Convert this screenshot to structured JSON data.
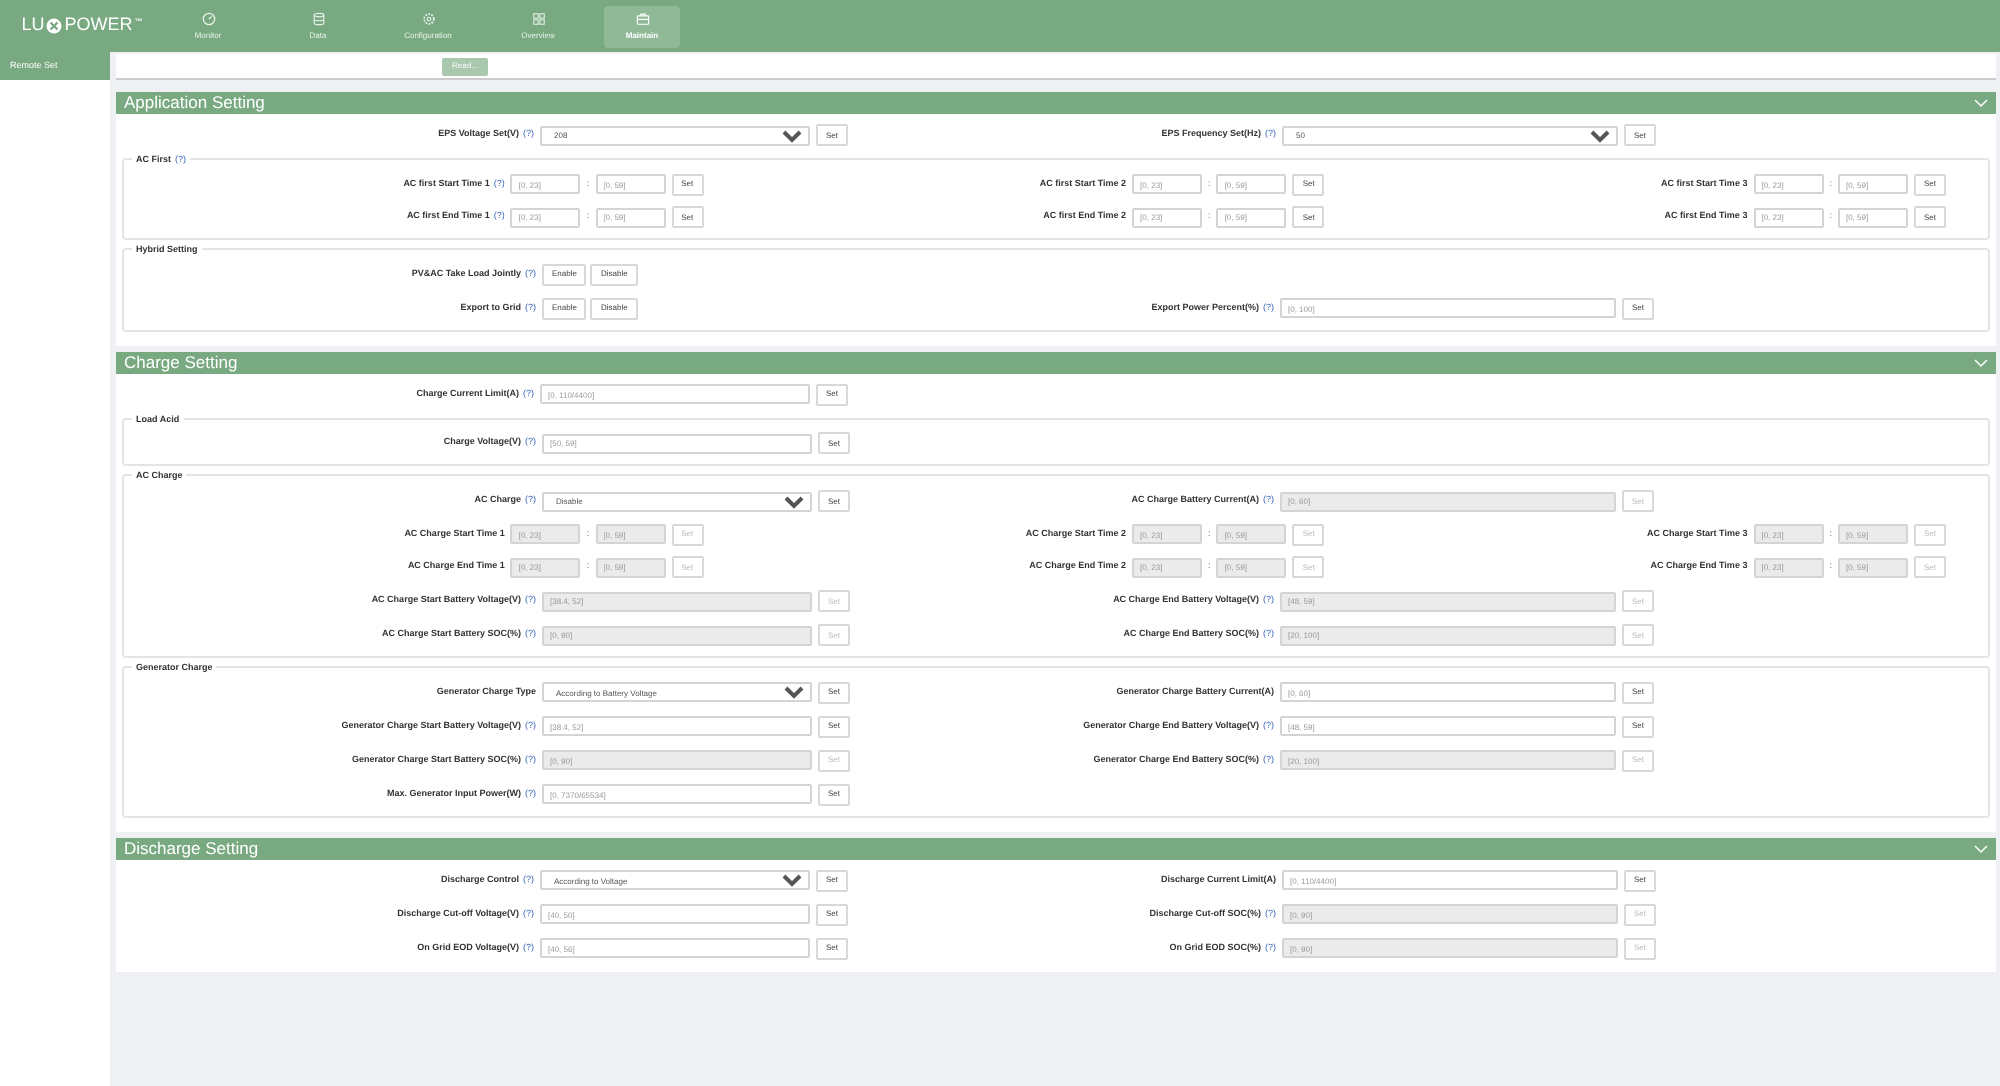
{
  "logo": {
    "before": "LU",
    "after": "POWER",
    "trademark": "™"
  },
  "nav": [
    {
      "label": "Monitor",
      "selected": false
    },
    {
      "label": "Data",
      "selected": false
    },
    {
      "label": "Configuration",
      "selected": false
    },
    {
      "label": "Overview",
      "selected": false
    },
    {
      "label": "Maintain",
      "selected": true
    }
  ],
  "sidebar": {
    "items": [
      {
        "label": "Remote Set",
        "selected": true
      }
    ]
  },
  "toolbar": {
    "read_button": "Read..."
  },
  "sections": [
    {
      "title": "Application Setting",
      "expanded": true,
      "items": [
        {
          "kind": "pair",
          "fields": [
            {
              "kind": "select",
              "label": "EPS Voltage Set(V)",
              "help": "(?)",
              "value": "208",
              "button": "Set",
              "disabled": false
            },
            {
              "kind": "select",
              "label": "EPS Frequency Set(Hz)",
              "help": "(?)",
              "value": "50",
              "button": "Set",
              "disabled": false
            }
          ]
        },
        {
          "kind": "group",
          "legend": "AC First",
          "help": "(?)",
          "items": [
            {
              "kind": "triple",
              "fields": [
                {
                  "kind": "time",
                  "label": "AC first Start Time 1",
                  "help": "(?)",
                  "placeholders": [
                    "[0, 23]",
                    "[0, 59]"
                  ],
                  "separator": ":",
                  "button": "Set",
                  "disabled": false
                },
                {
                  "kind": "time",
                  "label": "AC first Start Time 2",
                  "placeholders": [
                    "[0, 23]",
                    "[0, 59]"
                  ],
                  "separator": ":",
                  "button": "Set",
                  "disabled": false
                },
                {
                  "kind": "time",
                  "label": "AC first Start Time 3",
                  "placeholders": [
                    "[0, 23]",
                    "[0, 59]"
                  ],
                  "separator": ":",
                  "button": "Set",
                  "disabled": false
                }
              ]
            },
            {
              "kind": "triple",
              "fields": [
                {
                  "kind": "time",
                  "label": "AC first End Time 1",
                  "help": "(?)",
                  "placeholders": [
                    "[0, 23]",
                    "[0, 59]"
                  ],
                  "separator": ":",
                  "button": "Set",
                  "disabled": false
                },
                {
                  "kind": "time",
                  "label": "AC first End Time 2",
                  "placeholders": [
                    "[0, 23]",
                    "[0, 59]"
                  ],
                  "separator": ":",
                  "button": "Set",
                  "disabled": false
                },
                {
                  "kind": "time",
                  "label": "AC first End Time 3",
                  "placeholders": [
                    "[0, 23]",
                    "[0, 59]"
                  ],
                  "separator": ":",
                  "button": "Set",
                  "disabled": false
                }
              ]
            }
          ]
        },
        {
          "kind": "group",
          "legend": "Hybrid Setting",
          "items": [
            {
              "kind": "pair",
              "fields": [
                {
                  "kind": "toggle",
                  "label": "PV&AC Take Load Jointly",
                  "help": "(?)",
                  "options": [
                    "Enable",
                    "Disable"
                  ]
                }
              ]
            },
            {
              "kind": "pair",
              "fields": [
                {
                  "kind": "toggle",
                  "label": "Export to Grid",
                  "help": "(?)",
                  "options": [
                    "Enable",
                    "Disable"
                  ]
                },
                {
                  "kind": "input",
                  "label": "Export Power Percent(%)",
                  "help": "(?)",
                  "placeholder": "[0, 100]",
                  "button": "Set",
                  "disabled": false
                }
              ]
            }
          ]
        }
      ]
    },
    {
      "title": "Charge Setting",
      "expanded": true,
      "items": [
        {
          "kind": "pair",
          "fields": [
            {
              "kind": "input",
              "label": "Charge Current Limit(A)",
              "help": "(?)",
              "placeholder": "[0, 110/4400]",
              "button": "Set",
              "disabled": false
            }
          ]
        },
        {
          "kind": "group",
          "legend": "Load Acid",
          "items": [
            {
              "kind": "pair",
              "fields": [
                {
                  "kind": "input",
                  "label": "Charge Voltage(V)",
                  "help": "(?)",
                  "placeholder": "[50, 59]",
                  "button": "Set",
                  "disabled": false
                }
              ]
            }
          ]
        },
        {
          "kind": "group",
          "legend": "AC Charge",
          "items": [
            {
              "kind": "pair",
              "fields": [
                {
                  "kind": "select",
                  "label": "AC Charge",
                  "help": "(?)",
                  "value": "Disable",
                  "button": "Set",
                  "disabled": false
                },
                {
                  "kind": "input",
                  "label": "AC Charge Battery Current(A)",
                  "help": "(?)",
                  "placeholder": "[0, 60]",
                  "button": "Set",
                  "disabled": true
                }
              ]
            },
            {
              "kind": "triple",
              "fields": [
                {
                  "kind": "time",
                  "label": "AC Charge Start Time 1",
                  "placeholders": [
                    "[0, 23]",
                    "[0, 59]"
                  ],
                  "separator": ":",
                  "button": "Set",
                  "disabled": true
                },
                {
                  "kind": "time",
                  "label": "AC Charge Start Time 2",
                  "placeholders": [
                    "[0, 23]",
                    "[0, 59]"
                  ],
                  "separator": ":",
                  "button": "Set",
                  "disabled": true
                },
                {
                  "kind": "time",
                  "label": "AC Charge Start Time 3",
                  "placeholders": [
                    "[0, 23]",
                    "[0, 59]"
                  ],
                  "separator": ":",
                  "button": "Set",
                  "disabled": true
                }
              ]
            },
            {
              "kind": "triple",
              "fields": [
                {
                  "kind": "time",
                  "label": "AC Charge End Time 1",
                  "placeholders": [
                    "[0, 23]",
                    "[0, 59]"
                  ],
                  "separator": ":",
                  "button": "Set",
                  "disabled": true
                },
                {
                  "kind": "time",
                  "label": "AC Charge End Time 2",
                  "placeholders": [
                    "[0, 23]",
                    "[0, 59]"
                  ],
                  "separator": ":",
                  "button": "Set",
                  "disabled": true
                },
                {
                  "kind": "time",
                  "label": "AC Charge End Time 3",
                  "placeholders": [
                    "[0, 23]",
                    "[0, 59]"
                  ],
                  "separator": ":",
                  "button": "Set",
                  "disabled": true
                }
              ]
            },
            {
              "kind": "pair",
              "fields": [
                {
                  "kind": "input",
                  "label": "AC Charge Start Battery Voltage(V)",
                  "help": "(?)",
                  "placeholder": "[38.4, 52]",
                  "button": "Set",
                  "disabled": true
                },
                {
                  "kind": "input",
                  "label": "AC Charge End Battery Voltage(V)",
                  "help": "(?)",
                  "placeholder": "[48, 59]",
                  "button": "Set",
                  "disabled": true
                }
              ]
            },
            {
              "kind": "pair",
              "fields": [
                {
                  "kind": "input",
                  "label": "AC Charge Start Battery SOC(%)",
                  "help": "(?)",
                  "placeholder": "[0, 90]",
                  "button": "Set",
                  "disabled": true
                },
                {
                  "kind": "input",
                  "label": "AC Charge End Battery SOC(%)",
                  "help": "(?)",
                  "placeholder": "[20, 100]",
                  "button": "Set",
                  "disabled": true
                }
              ]
            }
          ]
        },
        {
          "kind": "group",
          "legend": "Generator Charge",
          "items": [
            {
              "kind": "pair",
              "fields": [
                {
                  "kind": "select",
                  "label": "Generator Charge Type",
                  "value": "According to Battery Voltage",
                  "button": "Set",
                  "disabled": false
                },
                {
                  "kind": "input",
                  "label": "Generator Charge Battery Current(A)",
                  "placeholder": "[0, 60]",
                  "button": "Set",
                  "disabled": false
                }
              ]
            },
            {
              "kind": "pair",
              "fields": [
                {
                  "kind": "input",
                  "label": "Generator Charge Start Battery Voltage(V)",
                  "help": "(?)",
                  "placeholder": "[38.4, 52]",
                  "button": "Set",
                  "disabled": false
                },
                {
                  "kind": "input",
                  "label": "Generator Charge End Battery Voltage(V)",
                  "help": "(?)",
                  "placeholder": "[48, 59]",
                  "button": "Set",
                  "disabled": false
                }
              ]
            },
            {
              "kind": "pair",
              "fields": [
                {
                  "kind": "input",
                  "label": "Generator Charge Start Battery SOC(%)",
                  "help": "(?)",
                  "placeholder": "[0, 90]",
                  "button": "Set",
                  "disabled": true
                },
                {
                  "kind": "input",
                  "label": "Generator Charge End Battery SOC(%)",
                  "help": "(?)",
                  "placeholder": "[20, 100]",
                  "button": "Set",
                  "disabled": true
                }
              ]
            },
            {
              "kind": "pair",
              "fields": [
                {
                  "kind": "input",
                  "label": "Max. Generator Input Power(W)",
                  "help": "(?)",
                  "placeholder": "[0, 7370/65534]",
                  "button": "Set",
                  "disabled": false
                }
              ]
            }
          ]
        }
      ]
    },
    {
      "title": "Discharge Setting",
      "expanded": true,
      "items": [
        {
          "kind": "pair",
          "fields": [
            {
              "kind": "select",
              "label": "Discharge Control",
              "help": "(?)",
              "value": "According to Voltage",
              "button": "Set",
              "disabled": false
            },
            {
              "kind": "input",
              "label": "Discharge Current Limit(A)",
              "placeholder": "[0, 110/4400]",
              "button": "Set",
              "disabled": false
            }
          ]
        },
        {
          "kind": "pair",
          "fields": [
            {
              "kind": "input",
              "label": "Discharge Cut-off Voltage(V)",
              "help": "(?)",
              "placeholder": "[40, 50]",
              "button": "Set",
              "disabled": false
            },
            {
              "kind": "input",
              "label": "Discharge Cut-off SOC(%)",
              "help": "(?)",
              "placeholder": "[0, 90]",
              "button": "Set",
              "disabled": true
            }
          ]
        },
        {
          "kind": "pair",
          "fields": [
            {
              "kind": "input",
              "label": "On Grid EOD Voltage(V)",
              "help": "(?)",
              "placeholder": "[40, 56]",
              "button": "Set",
              "disabled": false
            },
            {
              "kind": "input",
              "label": "On Grid EOD SOC(%)",
              "help": "(?)",
              "placeholder": "[0, 90]",
              "button": "Set",
              "disabled": true
            }
          ]
        }
      ]
    }
  ]
}
